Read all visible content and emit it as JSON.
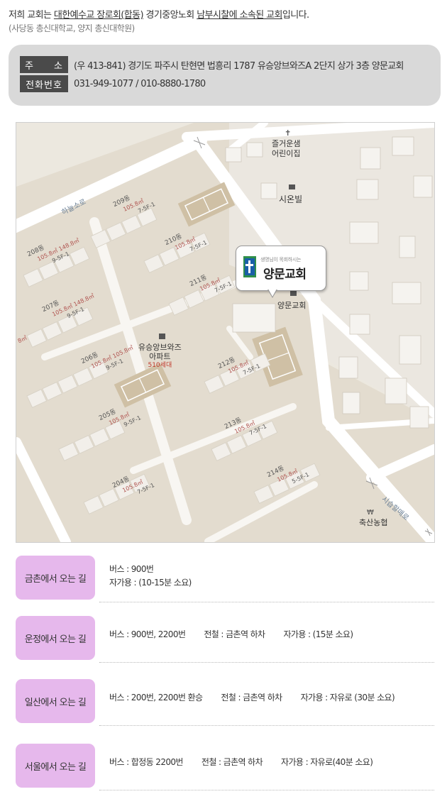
{
  "intro": {
    "prefix": "저희 교회는 ",
    "denomination": "대한예수교 장로회(합동)",
    "middle": " 경기중앙노회 ",
    "presbytery": "남부시찰에 소속된 교회",
    "suffix": "입니다.",
    "note": "(사당동 총신대학교, 양지 총신대학원)"
  },
  "address": {
    "addr_label": "주　　소",
    "addr_value": "(우 413-841) 경기도 파주시 탄현면 법흥리 1787 유승앙브와즈A 2단지 상가 3층 양문교회",
    "phone_label": "전화번호",
    "phone_value": "031-949-1077 / 010-8880-1780"
  },
  "map": {
    "logo_small": "생명님이 목회하시는",
    "logo_name": "양문교회",
    "church_label": "양문교회",
    "kindergarten_1": "즐거운샘",
    "kindergarten_2": "어린이집",
    "sion": "시온빌",
    "apt_1": "유승앙브와즈",
    "apt_2": "아파트",
    "households": "510세대",
    "bank": "축산농협",
    "road_left": "하늘소로",
    "road_right": "시습할매로",
    "buildings": [
      {
        "name": "209동",
        "area": "105.8㎡",
        "floor": "7-5F-1"
      },
      {
        "name": "208동",
        "area": "105.8㎡",
        "area2": "148.8㎡",
        "floor": "9-5F-1"
      },
      {
        "name": "210동",
        "area": "105.8㎡",
        "floor": "7-5F-1"
      },
      {
        "name": "207동",
        "area": "105.8㎡",
        "area2": "148.8㎡",
        "floor": "9-5F-1"
      },
      {
        "name": "211동",
        "area": "105.8㎡",
        "floor": "7-5F-1"
      },
      {
        "name": "206동",
        "area": "105.8㎡",
        "area2": "105.8㎡",
        "floor": "9-5F-1"
      },
      {
        "name": "212동",
        "area": "105.8㎡",
        "floor": "7-5F-1"
      },
      {
        "name": "205동",
        "area": "105.8㎡",
        "floor": "9-5F-1"
      },
      {
        "name": "213동",
        "area": "105.8㎡",
        "floor": "7-5F-1"
      },
      {
        "name": "204동",
        "area": "105.8㎡",
        "floor": "7-5F-1"
      },
      {
        "name": "214동",
        "area": "105.8㎡",
        "floor": "5-5F-1"
      }
    ],
    "edge_area": "8㎡"
  },
  "directions": [
    {
      "title": "금촌에서 오는 길",
      "lines": [
        [
          "버스 : 900번"
        ],
        [
          "자가용 : (10-15분 소요)"
        ]
      ]
    },
    {
      "title": "운정에서 오는 길",
      "lines": [
        [
          "버스 : 900번, 2200번",
          "전철 : 금촌역 하차",
          "자가용 : (15분 소요)"
        ]
      ]
    },
    {
      "title": "일산에서 오는 길",
      "lines": [
        [
          "버스 : 200번, 2200번 환승",
          "전철 : 금촌역 하차",
          "자가용 : 자유로 (30분 소요)"
        ]
      ]
    },
    {
      "title": "서울에서 오는 길",
      "lines": [
        [
          "버스 : 합정동 2200번",
          "전철 : 금촌역 하차",
          "자가용 : 자유로(40분 소요)"
        ]
      ]
    }
  ]
}
